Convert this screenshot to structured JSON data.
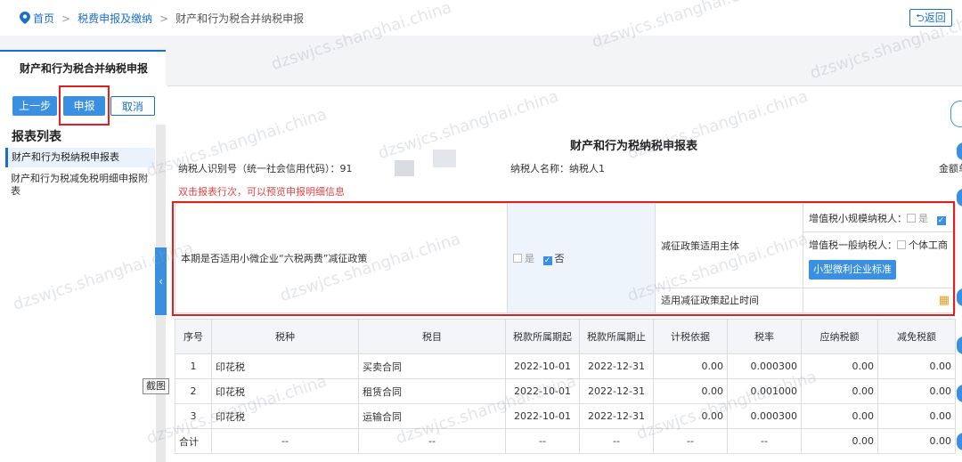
{
  "breadcrumb": {
    "home": "首页",
    "level1": "税费申报及缴纳",
    "current": "财产和行为税合并纳税申报",
    "sep": ">"
  },
  "back_label": "返回",
  "tab": "财产和行为税合并纳税申报",
  "toolbar": {
    "prev": "上一步",
    "submit": "申报",
    "cancel": "取消"
  },
  "report_list": {
    "title": "报表列表",
    "items": [
      "财产和行为税纳税申报表",
      "财产和行为税减免税明细申报附表"
    ]
  },
  "screenshot_tag": "截图",
  "form": {
    "title": "财产和行为税纳税申报表",
    "taxpayer_id": "纳税人识别号（统一社会信用代码）：91",
    "taxpayer_name": "纳税人名称：纳税人1",
    "amount_unit": "金额单",
    "hint": "双击报表行次，可以预览申报明细信息"
  },
  "policy": {
    "question": "本期是否适用小微企业“六税两费”减征政策",
    "yes": "是",
    "no": "否",
    "no_checked": true,
    "subject_label": "减征政策适用主体",
    "vat_small_label": "增值税小规模纳税人：",
    "vat_small_yes": "是",
    "vat_general_label": "增值税一般纳税人：",
    "vat_general_option": "个体工商",
    "small_profit_btn": "小型微利企业标准",
    "start_time_label": "适用减征政策起止时间"
  },
  "table": {
    "headers": [
      "序号",
      "税种",
      "税目",
      "税款所属期起",
      "税款所属期止",
      "计税依据",
      "税率",
      "应纳税额",
      "减免税额"
    ],
    "rows": [
      [
        "1",
        "印花税",
        "买卖合同",
        "2022-10-01",
        "2022-12-31",
        "0.00",
        "0.000300",
        "0.00",
        "0.00"
      ],
      [
        "2",
        "印花税",
        "租赁合同",
        "2022-10-01",
        "2022-12-31",
        "0.00",
        "0.001000",
        "0.00",
        "0.00"
      ],
      [
        "3",
        "印花税",
        "运输合同",
        "2022-10-01",
        "2022-12-31",
        "0.00",
        "0.000300",
        "0.00",
        "0.00"
      ]
    ],
    "total": [
      "合计",
      "--",
      "--",
      "--",
      "--",
      "--",
      "--",
      "0.00",
      "0.00"
    ]
  },
  "watermark": "dzswjcs.shanghai.china",
  "colors": {
    "accent": "#3a8fe0",
    "highlight": "#e02020",
    "hint": "#e04646"
  }
}
